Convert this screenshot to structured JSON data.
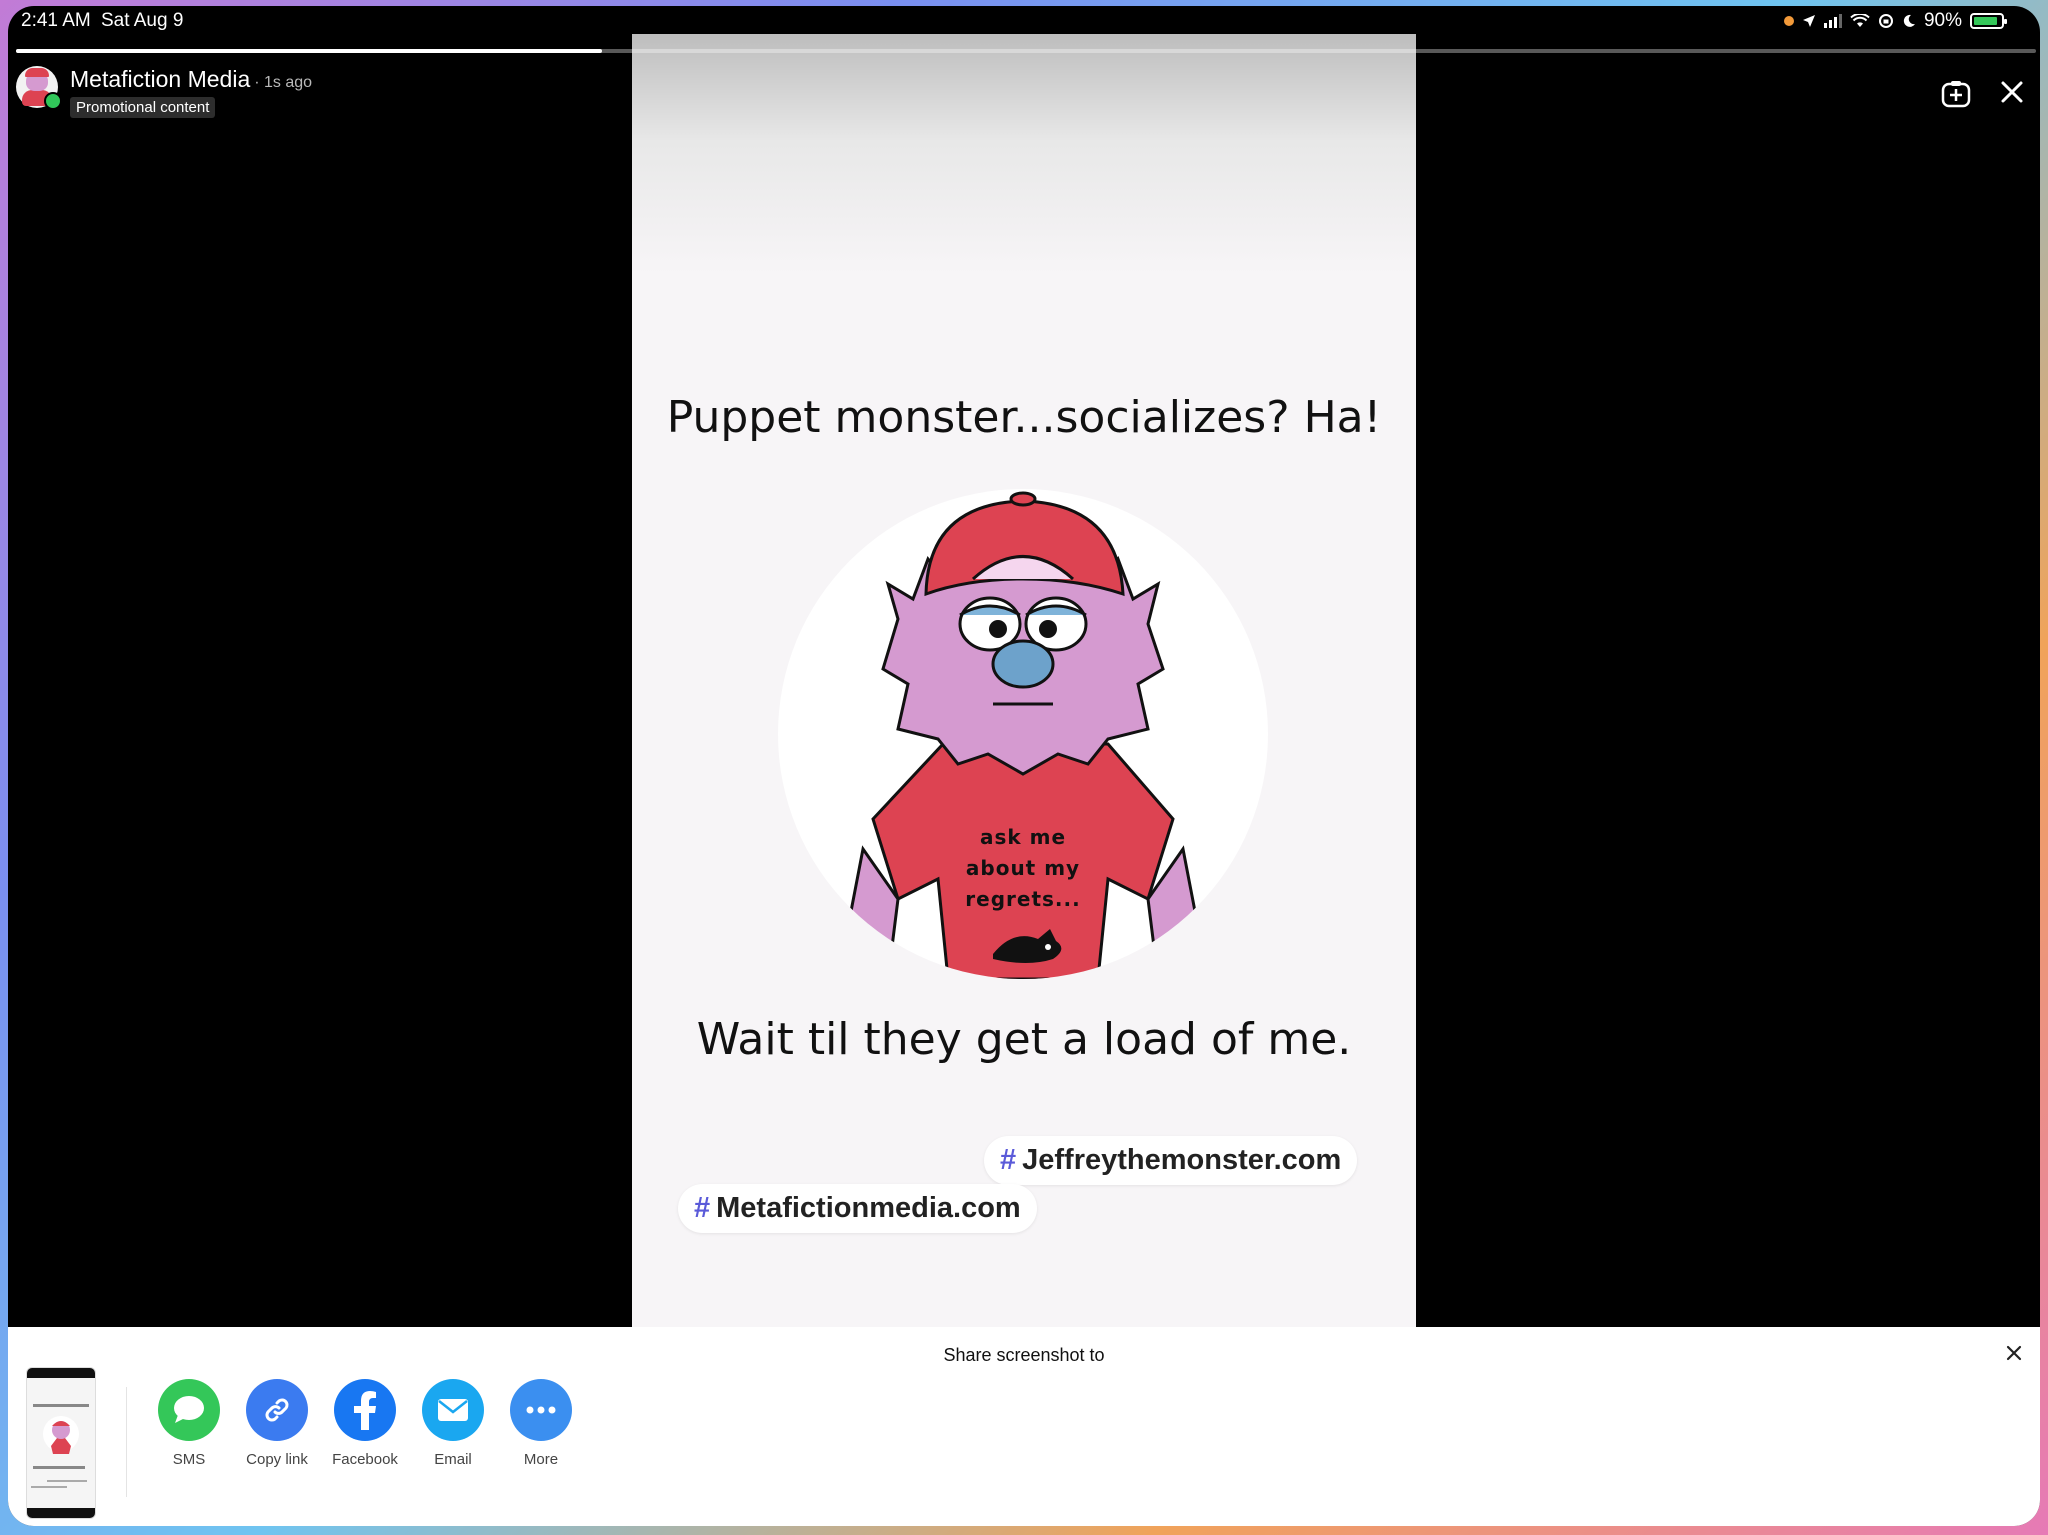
{
  "status_bar": {
    "time": "2:41 AM",
    "date": "Sat Aug 9",
    "battery": "90%",
    "icons": [
      "recording-dot-icon",
      "location-arrow-icon",
      "cellular-signal-icon",
      "wifi-icon",
      "screen-lock-rotation-icon",
      "moon-icon",
      "battery-charging-icon"
    ]
  },
  "story": {
    "progress_fraction": 0.29,
    "author": "Metafiction Media",
    "time_ago": "· 1s ago",
    "badge": "Promotional content",
    "headline": "Puppet monster...socializes? Ha!",
    "shirt_text": [
      "ask me",
      "about my",
      "regrets..."
    ],
    "tagline": "Wait til they get a load of me.",
    "hashtags": [
      {
        "hash": "#",
        "text": "Jeffreythemonster.com"
      },
      {
        "hash": "#",
        "text": "Metafictionmedia.com"
      }
    ]
  },
  "share": {
    "title": "Share screenshot to",
    "targets": [
      {
        "label": "SMS",
        "color": "#34c759",
        "icon": "message-bubble-icon"
      },
      {
        "label": "Copy link",
        "color": "#3b7bf0",
        "icon": "link-icon"
      },
      {
        "label": "Facebook",
        "color": "#1877f2",
        "icon": "facebook-icon"
      },
      {
        "label": "Email",
        "color": "#1aa7f0",
        "icon": "mail-icon"
      },
      {
        "label": "More",
        "color": "#3b8ff0",
        "icon": "more-dots-icon"
      }
    ]
  },
  "colors": {
    "cap_red": "#dd4352",
    "fur_pink": "#d59ad0",
    "nose_blue": "#6da2cb",
    "hashtag": "#5a5ad9"
  }
}
